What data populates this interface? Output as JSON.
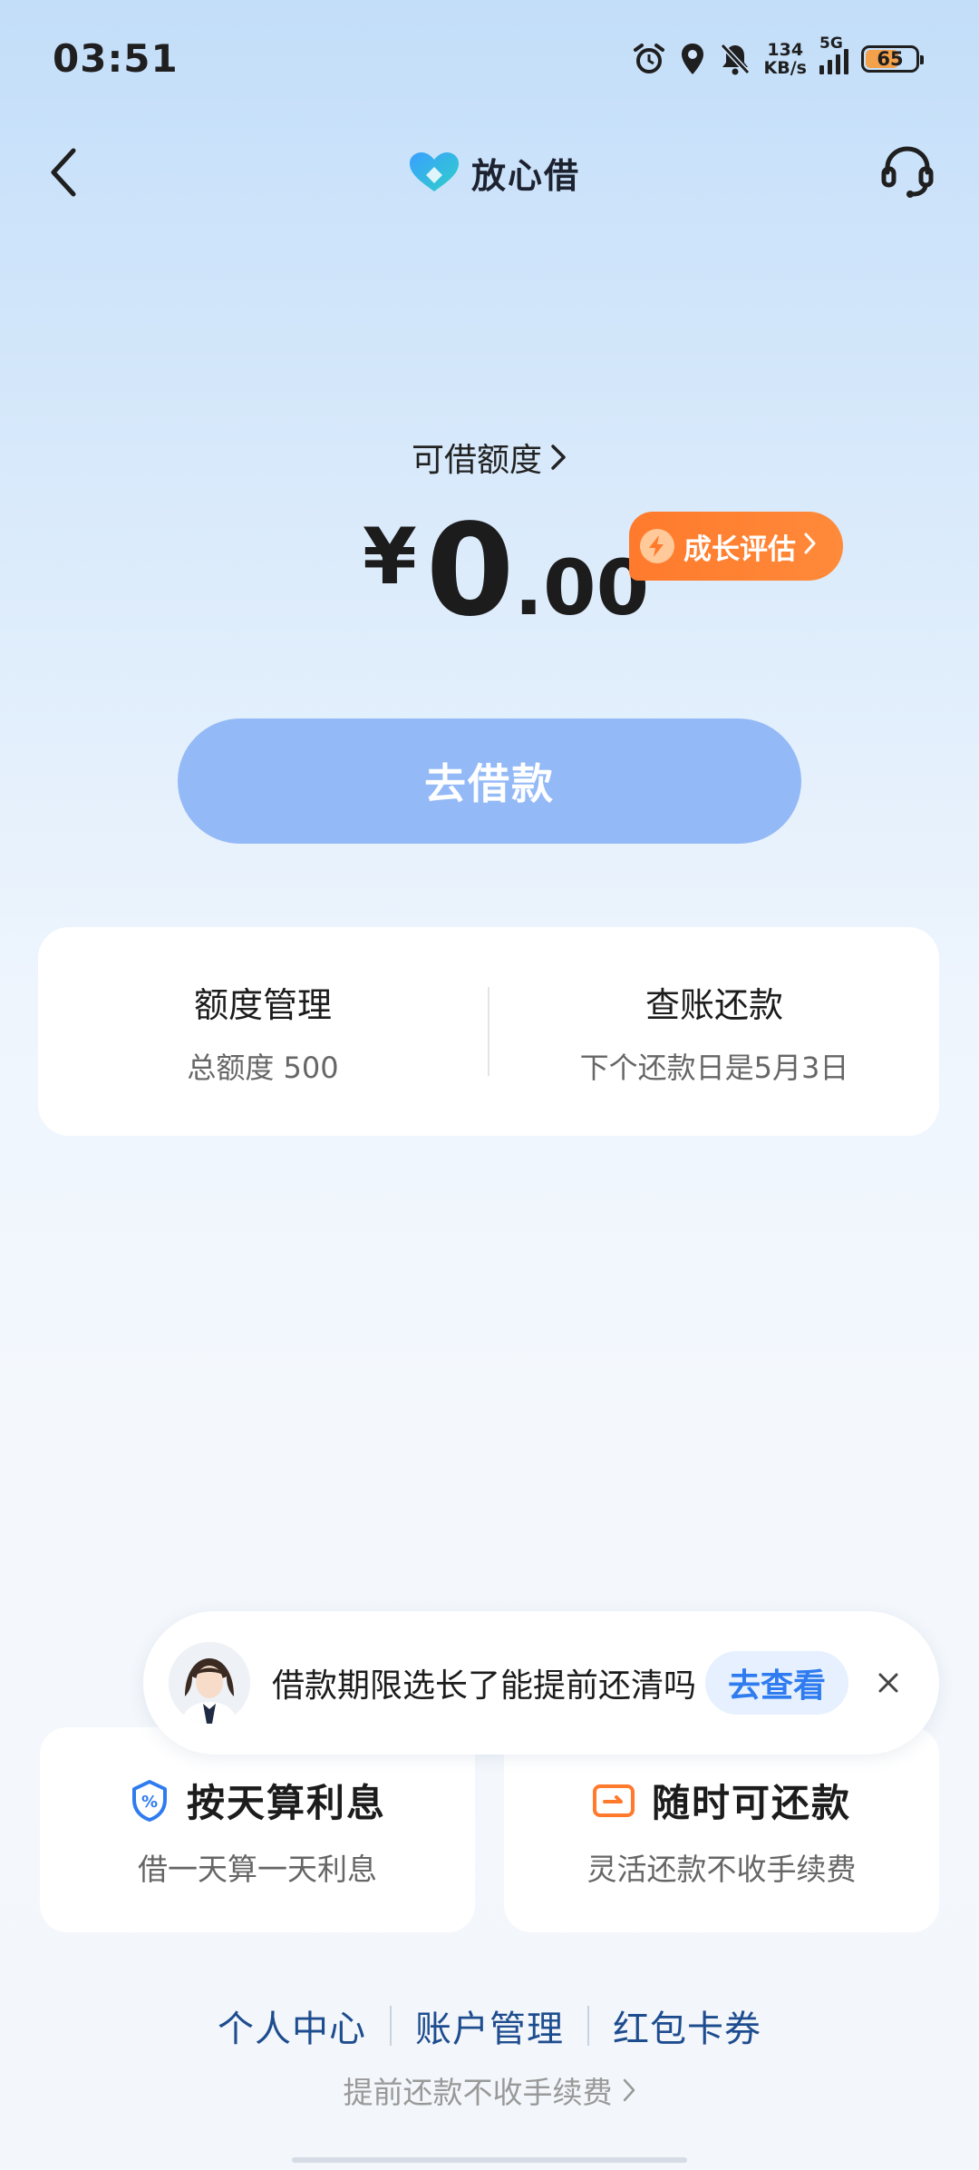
{
  "status_bar": {
    "time": "03:51",
    "net_speed_value": "134",
    "net_speed_unit": "KB/s",
    "network": "5G",
    "battery": "65",
    "icons": [
      "alarm-icon",
      "location-icon",
      "bell-muted-icon",
      "signal-icon",
      "battery-icon"
    ]
  },
  "nav": {
    "brand_name": "放心借",
    "back_icon": "back-chevron-icon",
    "service_icon": "headset-icon"
  },
  "quota": {
    "label": "可借额度",
    "currency": "¥",
    "amount_integer": "0",
    "amount_decimal": ".00",
    "growth_badge": "成长评估"
  },
  "borrow_button": "去借款",
  "manage": {
    "limit_title": "额度管理",
    "limit_subtitle": "总额度 500",
    "bill_title": "查账还款",
    "bill_subtitle": "下个还款日是5月3日"
  },
  "toast": {
    "message": "借款期限选长了能提前还清吗",
    "action": "去查看"
  },
  "features": [
    {
      "title": "按天算利息",
      "subtitle": "借一天算一天利息",
      "icon": "percent-shield-icon"
    },
    {
      "title": "随时可还款",
      "subtitle": "灵活还款不收手续费",
      "icon": "wallet-icon"
    }
  ],
  "bottom_links": [
    "个人中心",
    "账户管理",
    "红包卡券"
  ],
  "notice": "提前还款不收手续费",
  "colors": {
    "primary_button": "#93b9f7",
    "badge_orange": "#ff7a2c",
    "link_blue": "#1e4d8f",
    "accent_blue": "#2f7bf0"
  }
}
